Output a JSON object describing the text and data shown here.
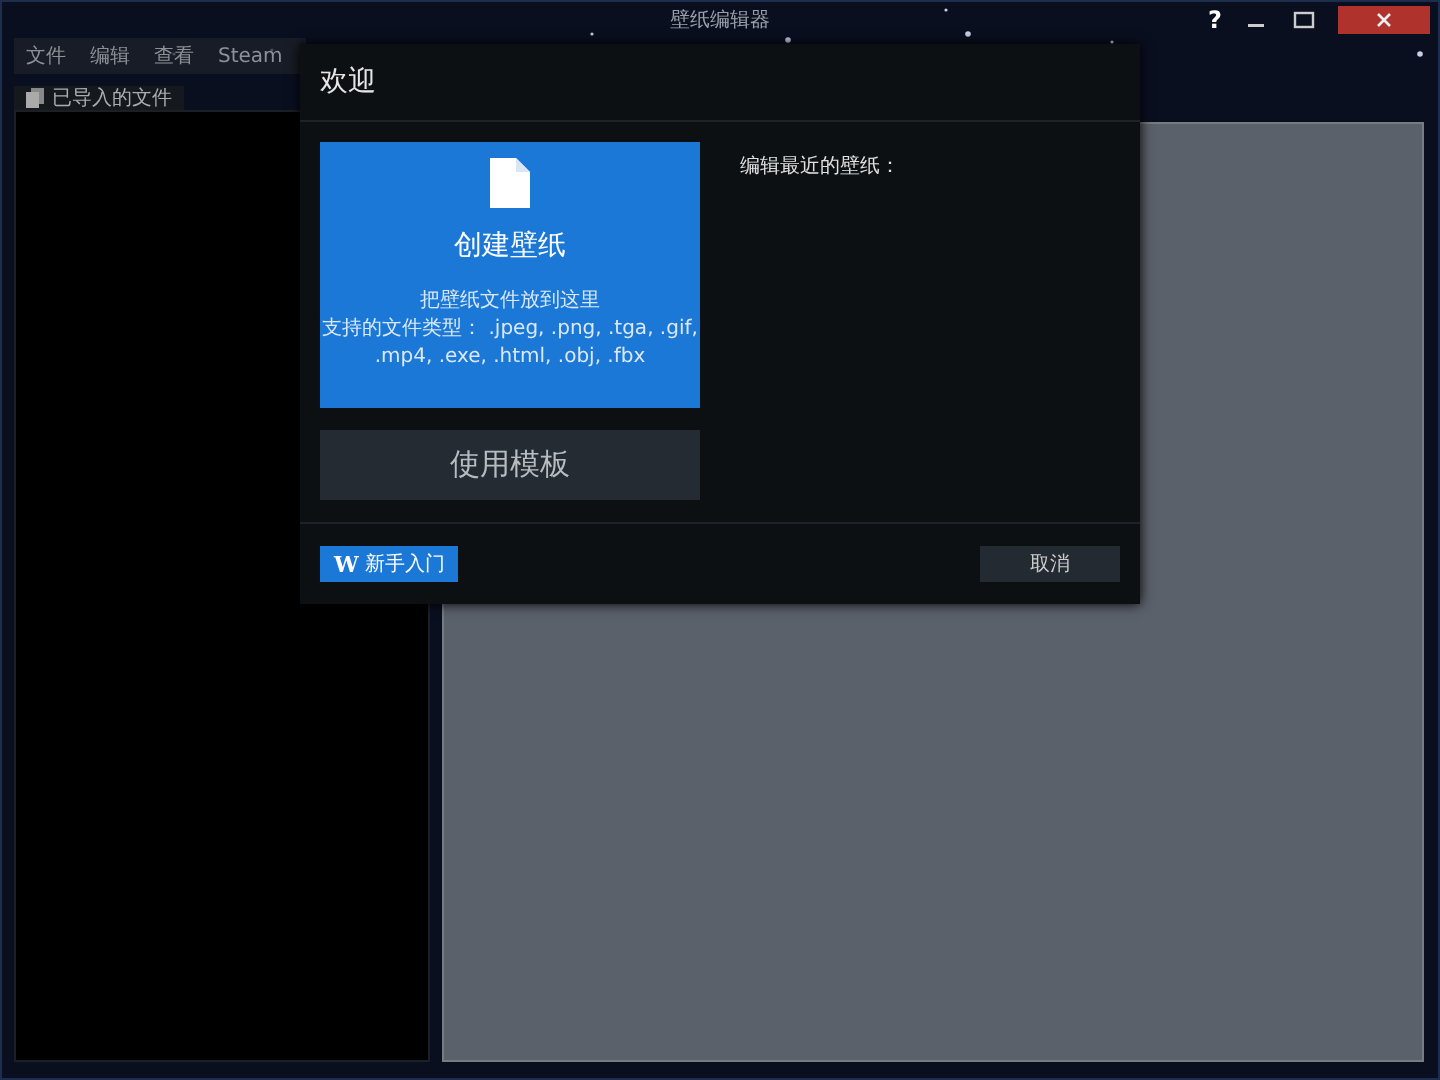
{
  "window": {
    "title": "壁纸编辑器",
    "help": "?"
  },
  "menu": [
    "文件",
    "编辑",
    "查看",
    "Steam"
  ],
  "left_panel": {
    "tab": "已导入的文件"
  },
  "dialog": {
    "title": "欢迎",
    "create_card": {
      "title": "创建壁纸",
      "lines": [
        "把壁纸文件放到这里",
        "支持的文件类型： .jpeg, .png, .tga, .gif,",
        ".mp4, .exe, .html, .obj, .fbx"
      ]
    },
    "template_button": "使用模板",
    "recent_label": "编辑最近的壁纸：",
    "guide_button": {
      "mark": "W",
      "label": "新手入门"
    },
    "cancel_button": "取消"
  }
}
